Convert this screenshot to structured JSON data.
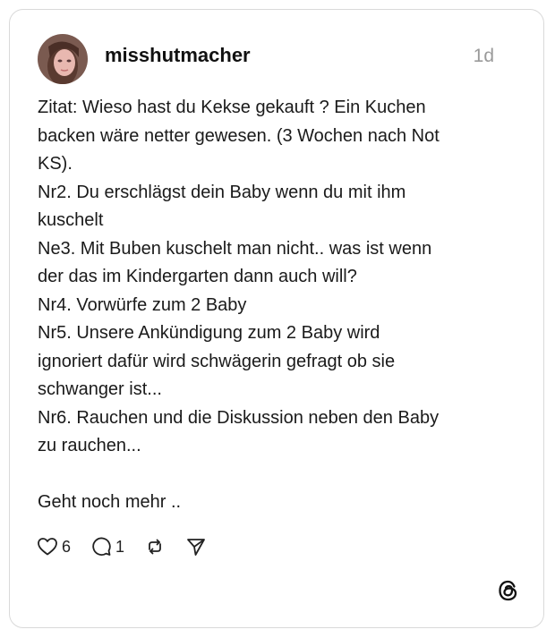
{
  "post": {
    "username": "misshutmacher",
    "timestamp": "1d",
    "body_lines": [
      "Zitat: Wieso hast du Kekse gekauft ? Ein Kuchen",
      "backen wäre netter gewesen. (3 Wochen nach Not",
      "KS).",
      "Nr2. Du erschlägst dein Baby wenn du mit ihm",
      "kuschelt",
      "Ne3. Mit Buben kuschelt man nicht.. was ist wenn",
      "der das im Kindergarten dann auch will?",
      "Nr4. Vorwürfe zum 2 Baby",
      "Nr5. Unsere Ankündigung zum 2 Baby wird",
      "ignoriert dafür wird schwägerin gefragt ob sie",
      "schwanger ist...",
      "Nr6. Rauchen und die Diskussion neben den Baby",
      "zu rauchen..."
    ],
    "closing_line": "Geht noch mehr .."
  },
  "actions": {
    "like_count": "6",
    "reply_count": "1"
  },
  "icons": {
    "like": "heart-icon",
    "reply": "speech-bubble-icon",
    "repost": "repost-icon",
    "share": "send-icon",
    "brand": "threads-logo-icon"
  },
  "colors": {
    "card_border": "#d9d9d9",
    "text": "#1a1a1a",
    "timestamp": "#9a9a9a"
  }
}
